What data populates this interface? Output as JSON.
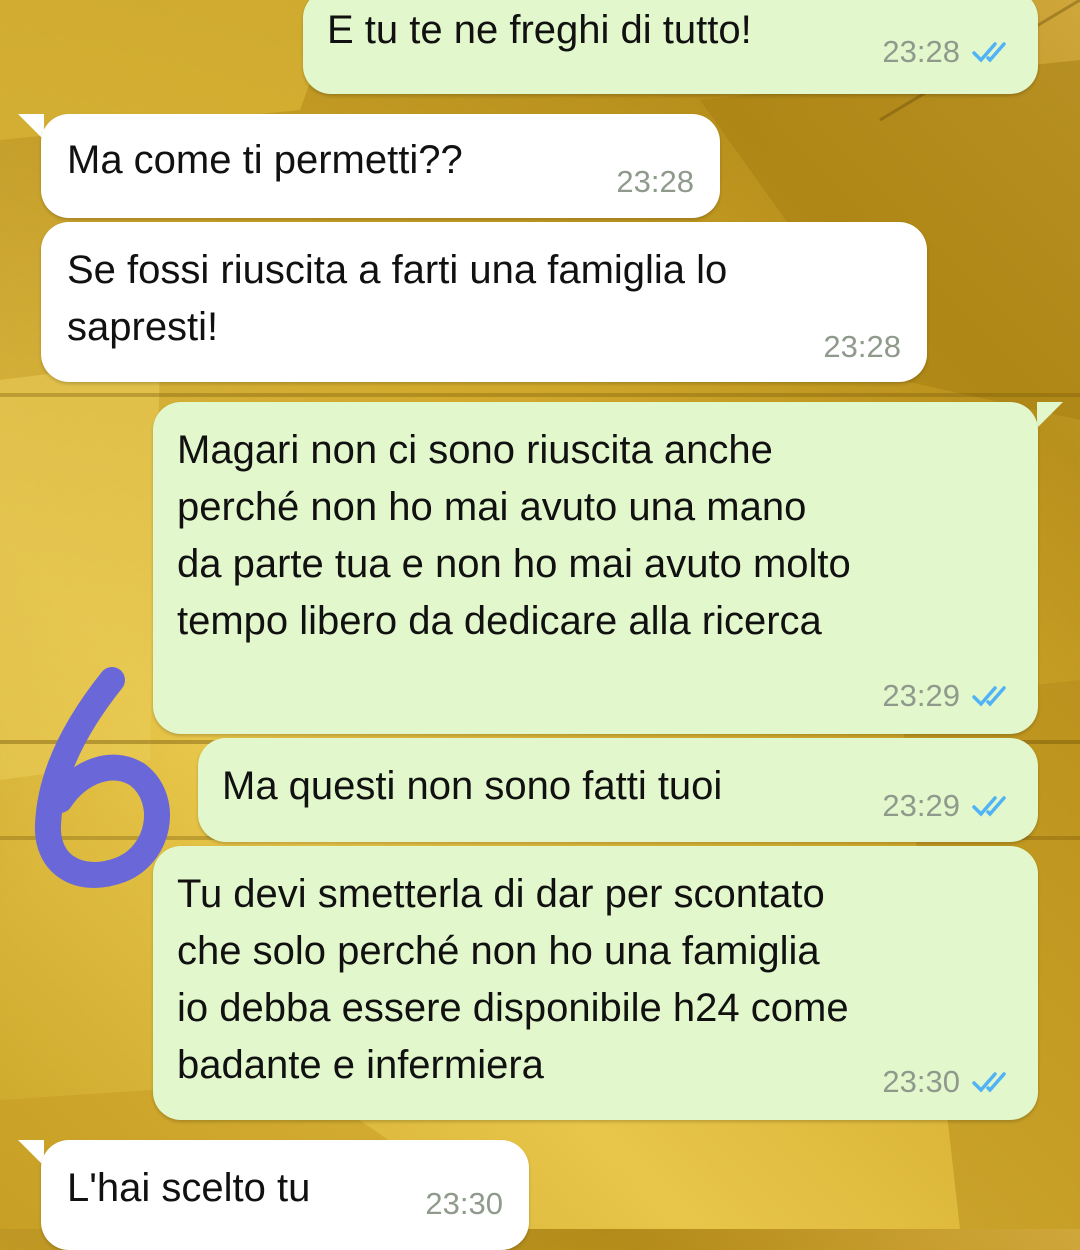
{
  "colors": {
    "outgoing_bubble": "#e2f7cb",
    "incoming_bubble": "#ffffff",
    "read_ticks": "#4fb3f6",
    "annotation": "#6a68d8"
  },
  "annotation": {
    "label": "6"
  },
  "messages": [
    {
      "direction": "outgoing",
      "text": "E tu te ne freghi di tutto!",
      "time": "23:28",
      "status": "read"
    },
    {
      "direction": "incoming",
      "text": "Ma come ti permetti??",
      "time": "23:28"
    },
    {
      "direction": "incoming",
      "text": "Se fossi riuscita a farti una famiglia lo\nsapresti!",
      "time": "23:28"
    },
    {
      "direction": "outgoing",
      "text": "Magari non ci sono riuscita anche\nperché non ho mai avuto una mano\nda parte tua e non ho mai avuto molto\ntempo libero da dedicare alla ricerca",
      "time": "23:29",
      "status": "read"
    },
    {
      "direction": "outgoing",
      "text": "Ma questi non sono fatti tuoi",
      "time": "23:29",
      "status": "read"
    },
    {
      "direction": "outgoing",
      "text": "Tu devi smetterla di dar per scontato\nche solo perché non ho una famiglia\nio debba essere disponibile h24 come\nbadante e infermiera",
      "time": "23:30",
      "status": "read"
    },
    {
      "direction": "incoming",
      "text": "L'hai scelto tu",
      "time": "23:30"
    }
  ]
}
